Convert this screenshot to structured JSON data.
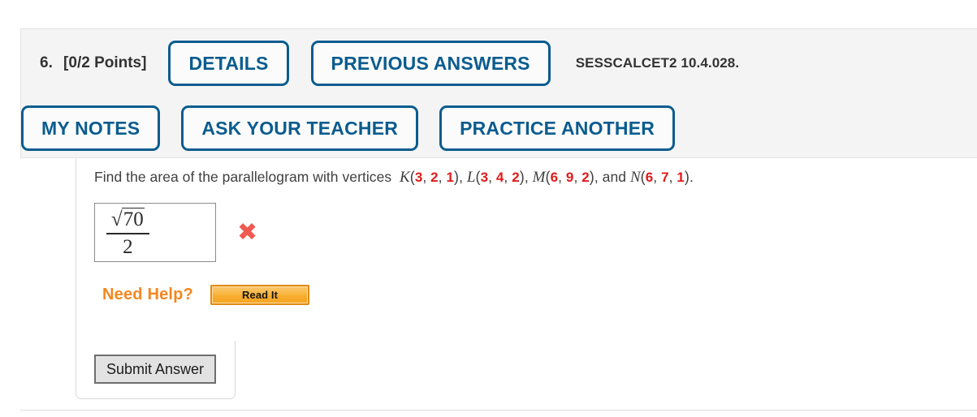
{
  "header": {
    "question_number": "6.",
    "points": "[0/2 Points]",
    "buttons_row1": [
      {
        "name": "details",
        "label": "DETAILS"
      },
      {
        "name": "previous-answers",
        "label": "PREVIOUS ANSWERS"
      }
    ],
    "reference_code": "SESSCALCET2 10.4.028.",
    "buttons_row2": [
      {
        "name": "my-notes",
        "label": "MY NOTES"
      },
      {
        "name": "ask-your-teacher",
        "label": "ASK YOUR TEACHER"
      },
      {
        "name": "practice-another",
        "label": "PRACTICE ANOTHER"
      }
    ]
  },
  "question": {
    "prompt_prefix": "Find the area of the parallelogram with vertices",
    "vertices": [
      {
        "label": "K",
        "coords": [
          "3",
          "2",
          "1"
        ]
      },
      {
        "label": "L",
        "coords": [
          "3",
          "4",
          "2"
        ]
      },
      {
        "label": "M",
        "coords": [
          "6",
          "9",
          "2"
        ]
      },
      {
        "label": "N",
        "coords": [
          "6",
          "7",
          "1"
        ]
      }
    ],
    "connector": "and",
    "terminator": "."
  },
  "answer": {
    "radical_symbol": "√",
    "radicand": "70",
    "denominator": "2",
    "grade_mark": "✖",
    "grade_mark_color": "#f0594f",
    "is_correct": false
  },
  "help": {
    "label": "Need Help?",
    "read_it_label": "Read It"
  },
  "footer": {
    "submit_label": "Submit Answer"
  },
  "colors": {
    "button_blue": "#0a5c8f",
    "header_bg": "#f4f4f4",
    "number_red": "#e01b1b",
    "help_orange": "#f5871f"
  }
}
